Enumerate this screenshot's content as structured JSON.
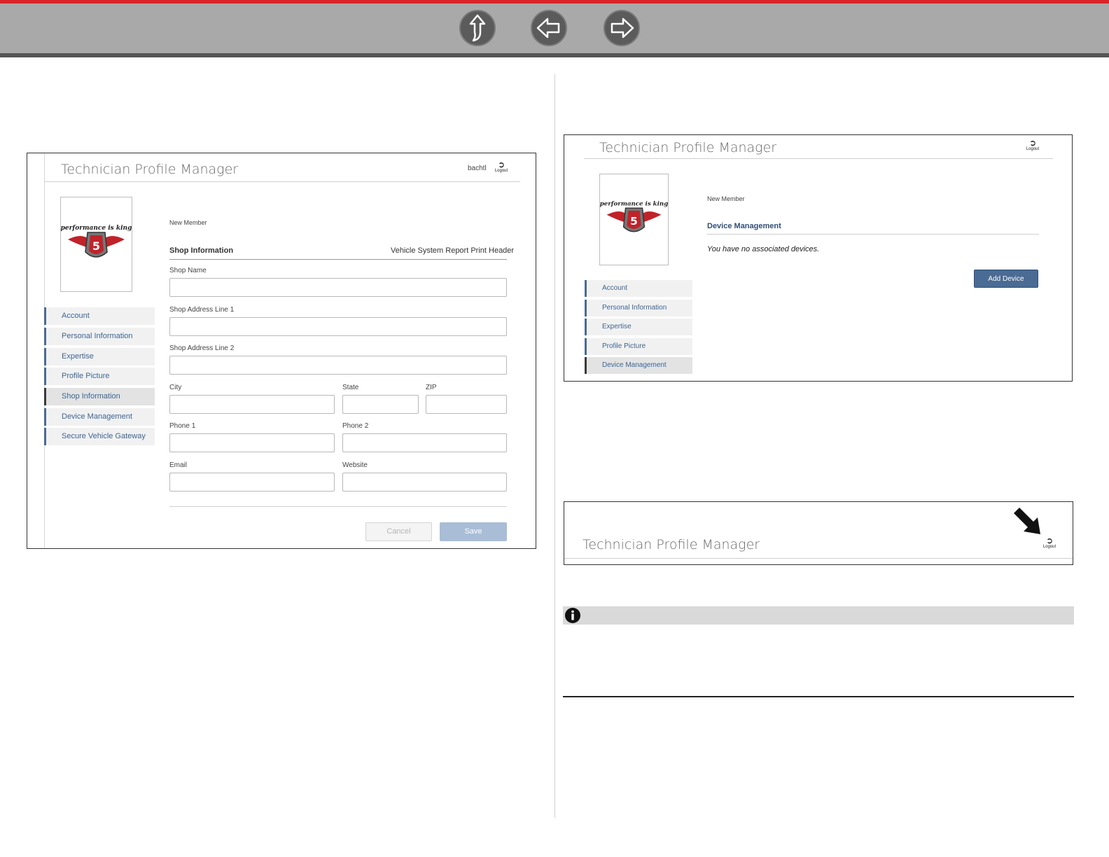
{
  "nav": {
    "home_icon": "home-up-arrow-icon",
    "back_icon": "back-arrow-icon",
    "forward_icon": "forward-arrow-icon"
  },
  "colors": {
    "accent_red": "#d9252a",
    "nav_blue": "#3c6595",
    "button_blue": "#4a6b93"
  },
  "fig1": {
    "title": "Technician Profile Manager",
    "username": "bachtl",
    "logout_label": "Logout",
    "member_status": "New Member",
    "section_title": "Shop Information",
    "section_link": "Vehicle System Report Print Header",
    "nav_items": [
      "Account",
      "Personal Information",
      "Expertise",
      "Profile Picture",
      "Shop Information",
      "Device Management",
      "Secure Vehicle Gateway"
    ],
    "active_item": "Shop Information",
    "fields": {
      "shop_name": "Shop Name",
      "address1": "Shop Address Line 1",
      "address2": "Shop Address Line 2",
      "city": "City",
      "state": "State",
      "zip": "ZIP",
      "phone1": "Phone 1",
      "phone2": "Phone 2",
      "email": "Email",
      "website": "Website"
    },
    "cancel_label": "Cancel",
    "save_label": "Save"
  },
  "fig2": {
    "title": "Technician Profile Manager",
    "logout_label": "Logout",
    "member_status": "New Member",
    "section_title": "Device Management",
    "empty_message": "You have no associated devices.",
    "add_device_label": "Add Device",
    "nav_items": [
      "Account",
      "Personal Information",
      "Expertise",
      "Profile Picture",
      "Device Management"
    ],
    "active_item": "Device Management"
  },
  "fig3": {
    "title": "Technician Profile Manager",
    "logout_label": "Logout"
  },
  "logo_text": "performance is king"
}
